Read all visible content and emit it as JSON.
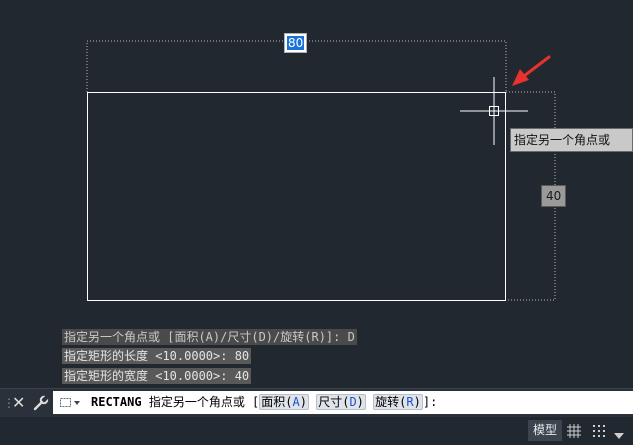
{
  "drawing": {
    "width_input": "80",
    "height_dim": "40",
    "tooltip": "指定另一个角点或"
  },
  "history": [
    "指定另一个角点或 [面积(A)/尺寸(D)/旋转(R)]: D",
    "指定矩形的长度 <10.0000>: 80",
    "指定矩形的宽度 <10.0000>: 40"
  ],
  "command": {
    "name": "RECTANG",
    "prompt": "指定另一个角点或 [",
    "options": [
      {
        "label": "面积(",
        "key": "A",
        "close": ")"
      },
      {
        "label": "尺寸(",
        "key": "D",
        "close": ")"
      },
      {
        "label": "旋转(",
        "key": "R",
        "close": ")"
      }
    ],
    "suffix": "]:"
  },
  "status": {
    "model_tab": "模型"
  },
  "icons": {
    "grip": "grip-icon",
    "close": "close-icon",
    "customize": "wrench-icon",
    "recent": "rectangle-dropdown-icon",
    "grid": "grid-icon",
    "snap": "snap-icon",
    "menu": "chevron-down-icon"
  },
  "colors": {
    "background": "#212830",
    "geometry": "#ffffff",
    "arrow": "#e8322e",
    "input_highlight": "#1a73d9",
    "command_key": "#1c52c8"
  }
}
